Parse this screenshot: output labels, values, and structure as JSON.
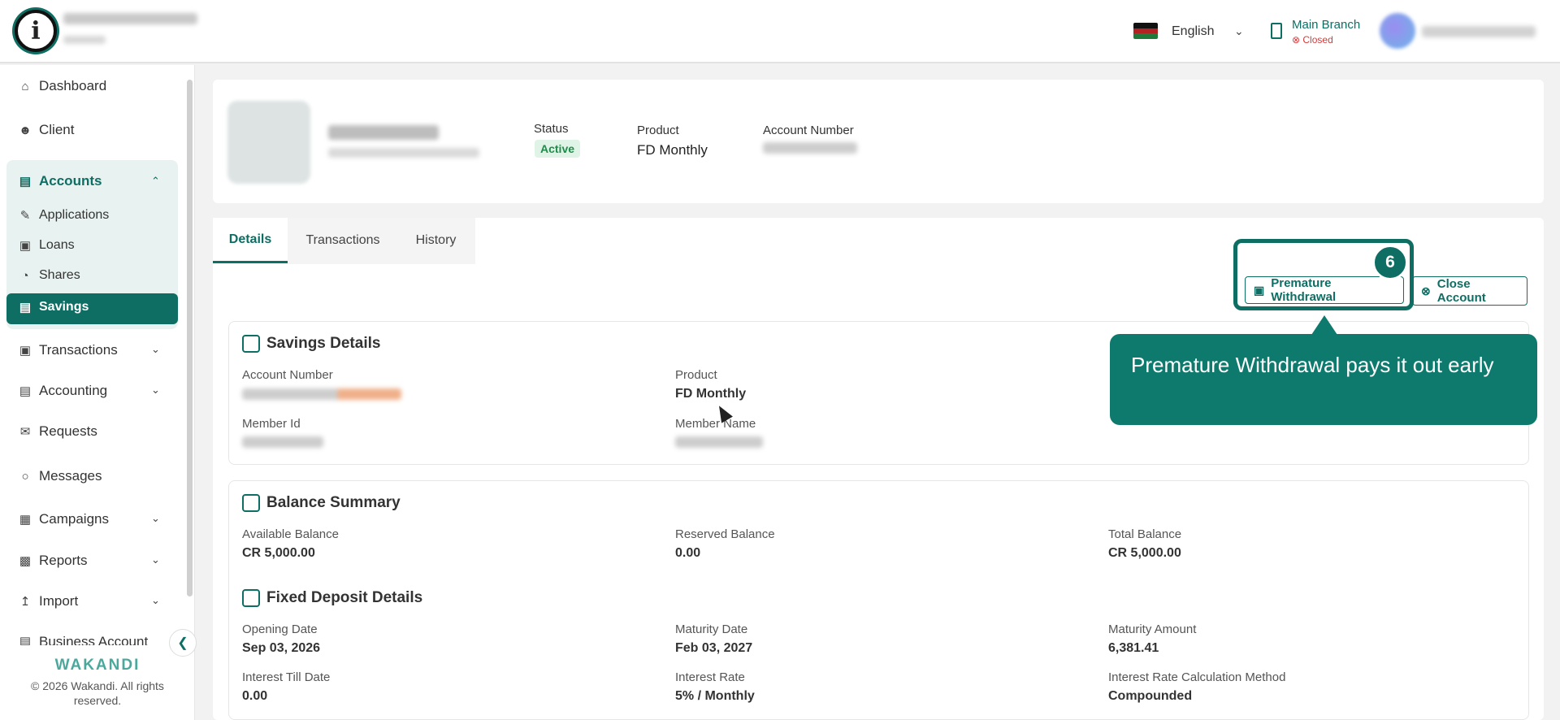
{
  "app": {
    "brand": "WAKANDI",
    "copyright": "© 2026 Wakandi. All rights reserved."
  },
  "topbar": {
    "language": "English",
    "branch_name": "Main Branch",
    "branch_status": "Closed"
  },
  "sidebar": {
    "items": [
      {
        "label": "Dashboard",
        "icon": "home-icon"
      },
      {
        "label": "Client",
        "icon": "users-icon"
      },
      {
        "label": "Accounts",
        "icon": "briefcase-icon"
      },
      {
        "label": "Applications",
        "icon": "file-edit-icon"
      },
      {
        "label": "Loans",
        "icon": "cash-icon"
      },
      {
        "label": "Shares",
        "icon": "pie-chart-icon"
      },
      {
        "label": "Savings",
        "icon": "wallet-icon"
      },
      {
        "label": "Transactions",
        "icon": "cash-icon"
      },
      {
        "label": "Accounting",
        "icon": "book-icon"
      },
      {
        "label": "Requests",
        "icon": "mail-icon"
      },
      {
        "label": "Messages",
        "icon": "chat-icon"
      },
      {
        "label": "Campaigns",
        "icon": "grid-icon"
      },
      {
        "label": "Reports",
        "icon": "bar-chart-icon"
      },
      {
        "label": "Import",
        "icon": "upload-icon"
      },
      {
        "label": "Business Account",
        "icon": "building-icon"
      }
    ]
  },
  "header": {
    "status_label": "Status",
    "status_value": "Active",
    "product_label": "Product",
    "product_value": "FD Monthly",
    "account_number_label": "Account Number"
  },
  "tabs": [
    {
      "label": "Details"
    },
    {
      "label": "Transactions"
    },
    {
      "label": "History"
    }
  ],
  "actions": {
    "premature_withdrawal": "Premature Withdrawal",
    "close_account": "Close Account"
  },
  "walkthrough": {
    "step": "6",
    "tooltip": "Premature Withdrawal pays it out early"
  },
  "savings_details": {
    "title": "Savings Details",
    "account_number_label": "Account Number",
    "product_label": "Product",
    "product_value": "FD Monthly",
    "member_id_label": "Member Id",
    "member_name_label": "Member Name"
  },
  "balance_summary": {
    "title": "Balance Summary",
    "available_label": "Available Balance",
    "available_value": "CR 5,000.00",
    "reserved_label": "Reserved Balance",
    "reserved_value": "0.00",
    "total_label": "Total Balance",
    "total_value": "CR 5,000.00"
  },
  "fixed_deposit": {
    "title": "Fixed Deposit Details",
    "opening_date_label": "Opening Date",
    "opening_date_value": "Sep 03, 2026",
    "maturity_date_label": "Maturity Date",
    "maturity_date_value": "Feb 03, 2027",
    "maturity_amount_label": "Maturity Amount",
    "maturity_amount_value": "6,381.41",
    "interest_till_label": "Interest Till Date",
    "interest_till_value": "0.00",
    "interest_rate_label": "Interest Rate",
    "interest_rate_value": "5% / Monthly",
    "calc_method_label": "Interest Rate Calculation Method",
    "calc_method_value": "Compounded"
  },
  "colors": {
    "primary": "#0e6e63",
    "active_status": "#1f8c4a",
    "closed_status": "#d43b3b"
  }
}
